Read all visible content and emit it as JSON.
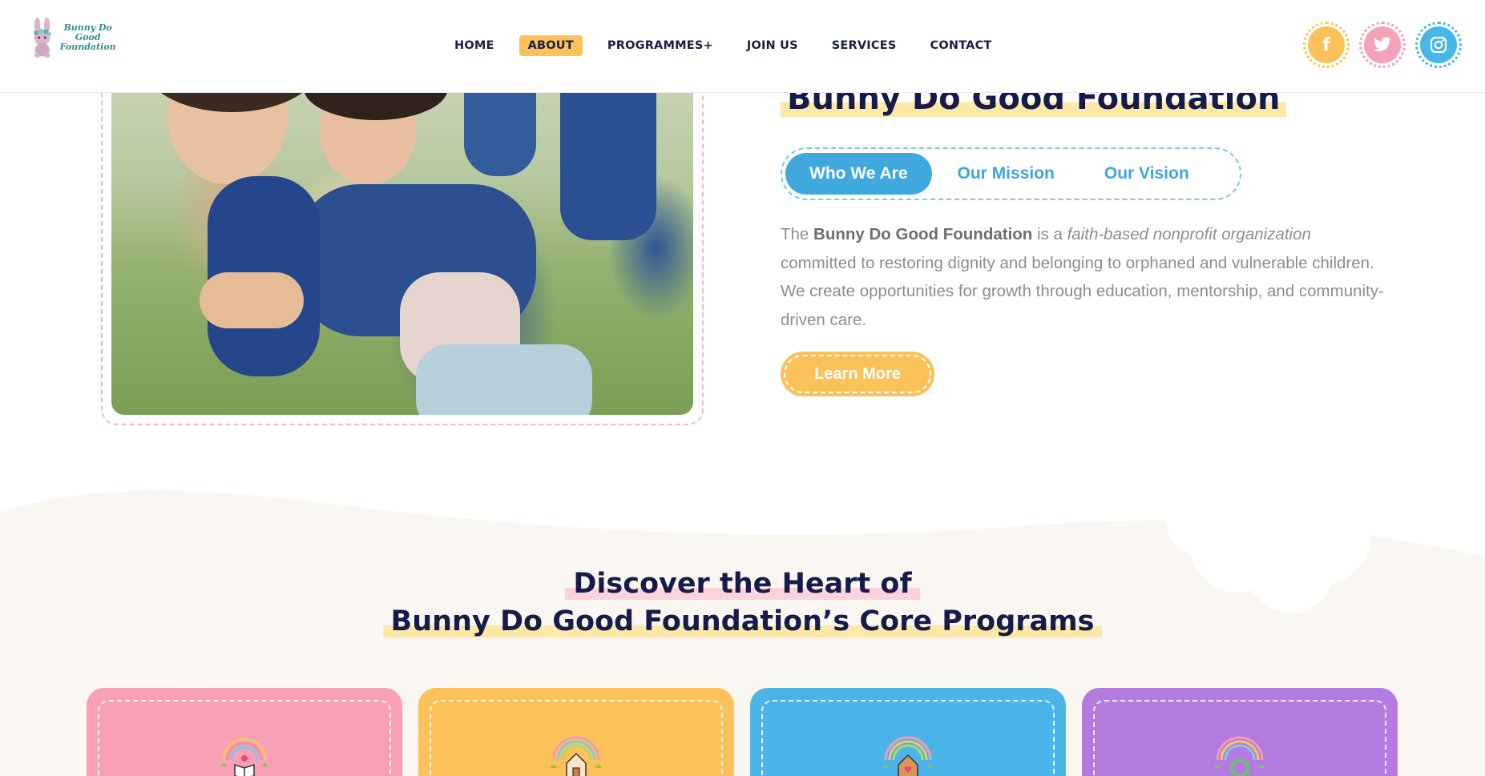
{
  "header": {
    "logo_text_line1": "Bunny Do Good",
    "logo_text_line2": "Foundation",
    "nav": [
      {
        "label": "HOME"
      },
      {
        "label": "ABOUT"
      },
      {
        "label": "PROGRAMMES+"
      },
      {
        "label": "JOIN US"
      },
      {
        "label": "SERVICES"
      },
      {
        "label": "CONTACT"
      }
    ],
    "socials": [
      {
        "icon": "facebook-icon",
        "glyph": "f",
        "color": "#fbc25a"
      },
      {
        "icon": "twitter-icon",
        "glyph": "🐦",
        "color": "#f5a1b8"
      },
      {
        "icon": "instagram-icon",
        "glyph": "◎",
        "color": "#48b6e6"
      }
    ]
  },
  "hero": {
    "title": "Bunny Do Good Foundation",
    "tabs": [
      {
        "label": "Who We Are",
        "active": true
      },
      {
        "label": "Our Mission",
        "active": false
      },
      {
        "label": "Our Vision",
        "active": false
      }
    ],
    "text": {
      "t1": "The ",
      "bold": "Bunny Do Good Foundation",
      "t2": " is a ",
      "italic": "faith-based nonprofit organization",
      "t3": " committed to restoring dignity and belonging to orphaned and vulnerable children. We create opportunities for growth through education, mentorship, and community-driven care."
    },
    "button_label": "Learn More"
  },
  "programs": {
    "title_line1": "Discover the Heart of",
    "title_line2": "Bunny Do Good Foundation’s Core Programs",
    "cards": [
      {
        "color": "#f8a1b6",
        "icon": "book-rainbow-icon"
      },
      {
        "color": "#fdc15a",
        "icon": "house-rainbow-icon"
      },
      {
        "color": "#4bb4e8",
        "icon": "heart-house-rainbow-icon"
      },
      {
        "color": "#b37be0",
        "icon": "recycle-rainbow-icon"
      }
    ]
  },
  "colors": {
    "navy": "#161b4a",
    "yellow": "#fbc25a",
    "pink": "#f5a1b8",
    "blue": "#48b6e6",
    "purple": "#b37be0",
    "cream": "#faf7f2"
  }
}
